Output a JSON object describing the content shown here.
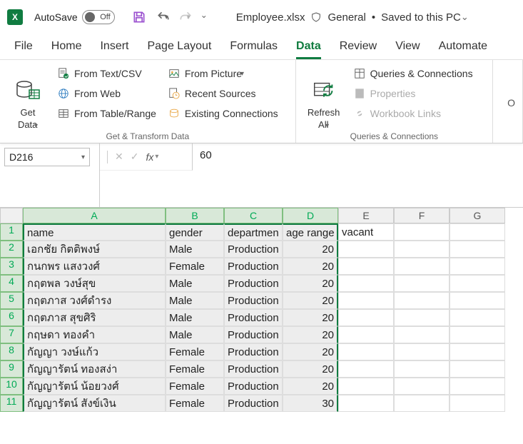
{
  "titlebar": {
    "autosave_label": "AutoSave",
    "autosave_state": "Off",
    "filename": "Employee.xlsx",
    "sensitivity": "General",
    "save_location": "Saved to this PC"
  },
  "tabs": {
    "file": "File",
    "home": "Home",
    "insert": "Insert",
    "page_layout": "Page Layout",
    "formulas": "Formulas",
    "data": "Data",
    "review": "Review",
    "view": "View",
    "automate": "Automate"
  },
  "ribbon": {
    "group1_label": "Get & Transform Data",
    "get_data": "Get",
    "get_data2": "Data",
    "from_text_csv": "From Text/CSV",
    "from_web": "From Web",
    "from_table_range": "From Table/Range",
    "from_picture": "From Picture",
    "recent_sources": "Recent Sources",
    "existing_connections": "Existing Connections",
    "group2_label": "Queries & Connections",
    "refresh_all": "Refresh",
    "refresh_all2": "All",
    "queries_connections": "Queries & Connections",
    "properties": "Properties",
    "workbook_links": "Workbook Links"
  },
  "formula_bar": {
    "name_box": "D216",
    "value": "60"
  },
  "sheet": {
    "columns": [
      "A",
      "B",
      "C",
      "D",
      "E",
      "F",
      "G"
    ],
    "header_row": [
      "name",
      "gender",
      "departmen",
      "age range",
      "vacant",
      "",
      ""
    ],
    "rows": [
      {
        "n": 2,
        "a": "เอกชัย กิตติพงษ์",
        "b": "Male",
        "c": "Production",
        "d": "20"
      },
      {
        "n": 3,
        "a": "กนกพร แสงวงศ์",
        "b": "Female",
        "c": "Production",
        "d": "20"
      },
      {
        "n": 4,
        "a": "กฤตพล วงษ์สุข",
        "b": "Male",
        "c": "Production",
        "d": "20"
      },
      {
        "n": 5,
        "a": "กฤตภาส วงศ์ดำรง",
        "b": "Male",
        "c": "Production",
        "d": "20"
      },
      {
        "n": 6,
        "a": "กฤตภาส สุขศิริ",
        "b": "Male",
        "c": "Production",
        "d": "20"
      },
      {
        "n": 7,
        "a": "กฤษดา ทองคำ",
        "b": "Male",
        "c": "Production",
        "d": "20"
      },
      {
        "n": 8,
        "a": "กัญญา วงษ์แก้ว",
        "b": "Female",
        "c": "Production",
        "d": "20"
      },
      {
        "n": 9,
        "a": "กัญญารัตน์ ทองสง่า",
        "b": "Female",
        "c": "Production",
        "d": "20"
      },
      {
        "n": 10,
        "a": "กัญญารัตน์ น้อยวงศ์",
        "b": "Female",
        "c": "Production",
        "d": "20"
      },
      {
        "n": 11,
        "a": "กัญญารัตน์ สังข์เงิน",
        "b": "Female",
        "c": "Production",
        "d": "30"
      }
    ]
  }
}
